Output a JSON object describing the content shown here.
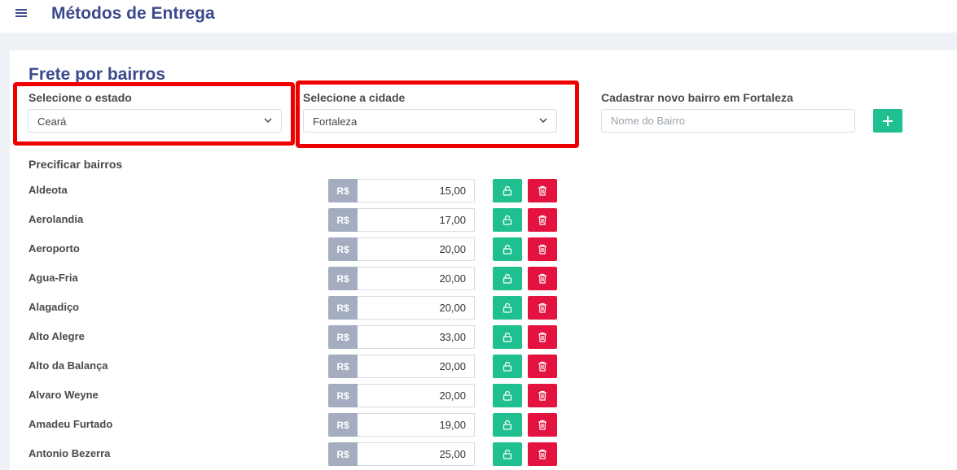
{
  "header": {
    "title": "Métodos de Entrega"
  },
  "section": {
    "title": "Frete por bairros",
    "state_label": "Selecione o estado",
    "state_value": "Ceará",
    "city_label": "Selecione a cidade",
    "city_value": "Fortaleza",
    "new_label": "Cadastrar novo bairro em Fortaleza",
    "new_placeholder": "Nome do Bairro",
    "list_label": "Precificar bairros",
    "currency": "R$"
  },
  "colors": {
    "brand": "#3c4a8c",
    "success": "#1fbf8f",
    "danger": "#e3123f",
    "highlight": "#ee0000"
  },
  "icons": {
    "menu": "hamburger-icon",
    "add": "plus-icon",
    "unlock": "lock-icon",
    "delete": "trash-icon",
    "dropdown": "chevron-down-icon"
  },
  "neighborhoods": [
    {
      "name": "Aldeota",
      "price": "15,00"
    },
    {
      "name": "Aerolandia",
      "price": "17,00"
    },
    {
      "name": "Aeroporto",
      "price": "20,00"
    },
    {
      "name": "Agua-Fria",
      "price": "20,00"
    },
    {
      "name": "Alagadiço",
      "price": "20,00"
    },
    {
      "name": "Alto Alegre",
      "price": "33,00"
    },
    {
      "name": "Alto da Balança",
      "price": "20,00"
    },
    {
      "name": "Alvaro Weyne",
      "price": "20,00"
    },
    {
      "name": "Amadeu Furtado",
      "price": "19,00"
    },
    {
      "name": "Antonio Bezerra",
      "price": "25,00"
    }
  ]
}
